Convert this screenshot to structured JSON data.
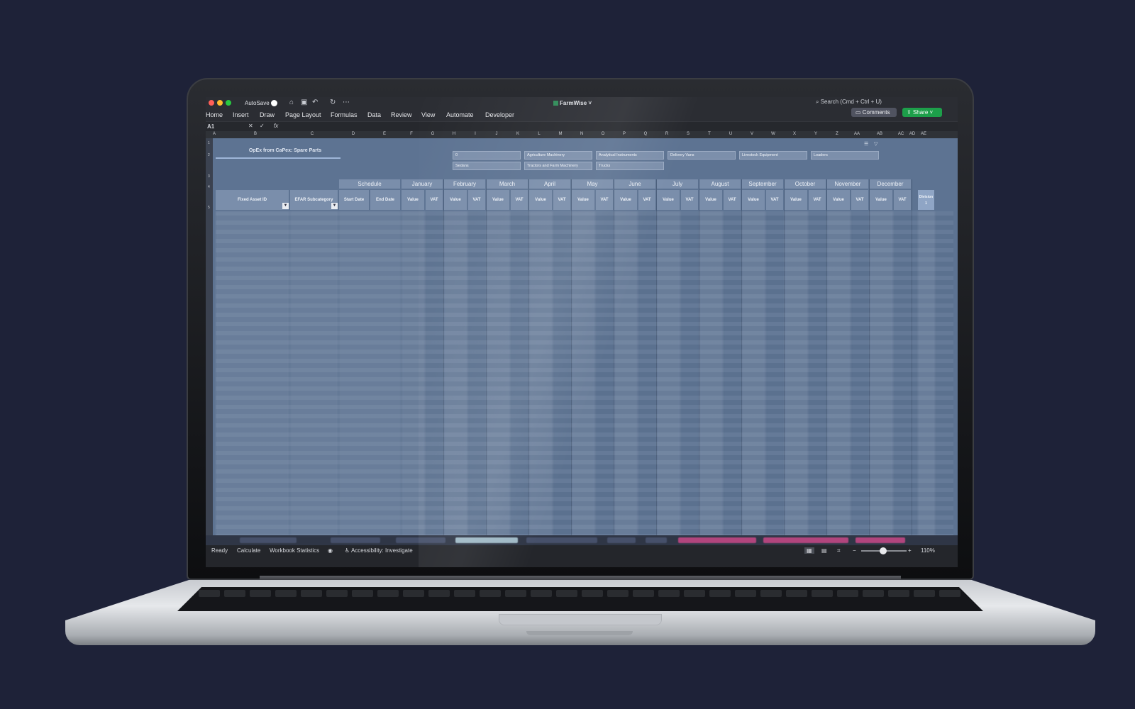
{
  "app": {
    "file_name": "FarmWise",
    "autosave_label": "AutoSave",
    "search_placeholder": "Search (Cmd + Ctrl + U)"
  },
  "ribbon": {
    "tabs": [
      "Home",
      "Insert",
      "Draw",
      "Page Layout",
      "Formulas",
      "Data",
      "Review",
      "View",
      "Automate",
      "Developer"
    ],
    "comments_label": "Comments",
    "share_label": "Share"
  },
  "formula_bar": {
    "name_box": "A1",
    "fx": "fx"
  },
  "columns": [
    "A",
    "B",
    "C",
    "D",
    "E",
    "F",
    "G",
    "H",
    "I",
    "J",
    "K",
    "L",
    "M",
    "N",
    "O",
    "P",
    "Q",
    "R",
    "S",
    "T",
    "U",
    "V",
    "W",
    "X",
    "Y",
    "Z",
    "AA",
    "AB",
    "AC",
    "AD",
    "AE"
  ],
  "rows": [
    "1",
    "2",
    "3",
    "4",
    "5"
  ],
  "sheet": {
    "title": "OpEx from CaPex: Spare Parts",
    "categories": [
      "0",
      "Agriculture Machinery",
      "Analytical Instruments",
      "Delivery Vans",
      "Livestock Equipment",
      "Loaders",
      "Sedans",
      "Tractors and Farm Machinery",
      "Trucks"
    ],
    "headers": {
      "fixed_asset_id": "Fixed Asset ID",
      "efar_subcategory": "EFAR Subcategory",
      "schedule": "Schedule",
      "start_date": "Start Date",
      "end_date": "End Date",
      "value": "Value",
      "vat": "VAT",
      "division": "Division 1"
    },
    "months": [
      "January",
      "February",
      "March",
      "April",
      "May",
      "June",
      "July",
      "August",
      "September",
      "October",
      "November",
      "December"
    ]
  },
  "status": {
    "ready": "Ready",
    "calculate": "Calculate",
    "workbook_statistics": "Workbook Statistics",
    "accessibility": "Accessibility: Investigate",
    "zoom": "110%",
    "zoom_level_percent": 110
  },
  "colors": {
    "background": "#1e2238",
    "sheet_fill": "#5d7392",
    "header_fill": "#7a8eab",
    "share_green": "#1d9f4a"
  }
}
